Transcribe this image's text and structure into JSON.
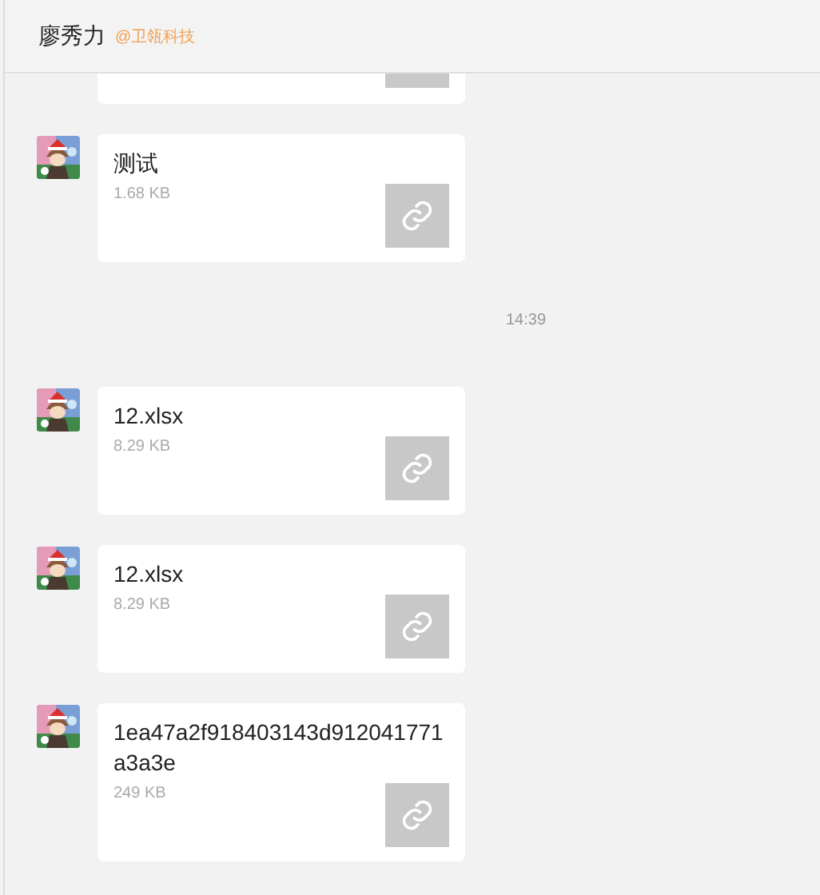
{
  "header": {
    "name": "廖秀力",
    "company": "@卫瓴科技"
  },
  "messages": [
    {
      "kind": "clipped"
    },
    {
      "kind": "file",
      "name": "测试",
      "size": "1.68 KB"
    },
    {
      "kind": "time",
      "text": "14:39"
    },
    {
      "kind": "file",
      "name": "12.xlsx",
      "size": "8.29 KB"
    },
    {
      "kind": "file",
      "name": "12.xlsx",
      "size": "8.29 KB"
    },
    {
      "kind": "file",
      "name": "1ea47a2f918403143d912041771a3a3e",
      "size": "249 KB"
    }
  ]
}
